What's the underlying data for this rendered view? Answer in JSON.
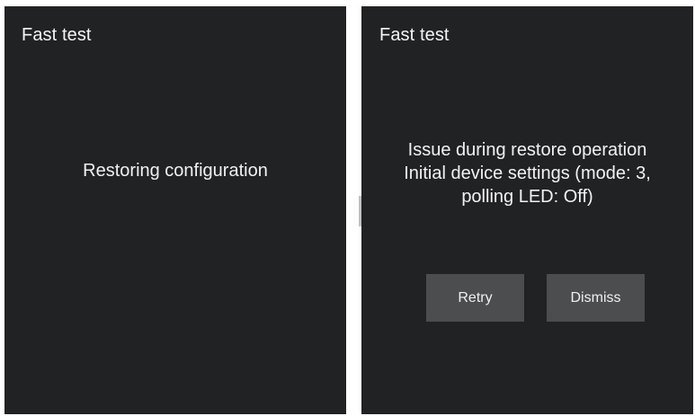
{
  "left_screen": {
    "title": "Fast test",
    "status": "Restoring configuration"
  },
  "right_screen": {
    "title": "Fast test",
    "message_lines": [
      "Issue during restore operation",
      "Initial device settings (mode: 3,",
      "polling LED: Off)"
    ],
    "retry_label": "Retry",
    "dismiss_label": "Dismiss"
  },
  "colors": {
    "screen_bg": "#202224",
    "button_bg": "#4b4d4e",
    "text": "#f2f2f2",
    "page_bg": "#ffffff"
  }
}
